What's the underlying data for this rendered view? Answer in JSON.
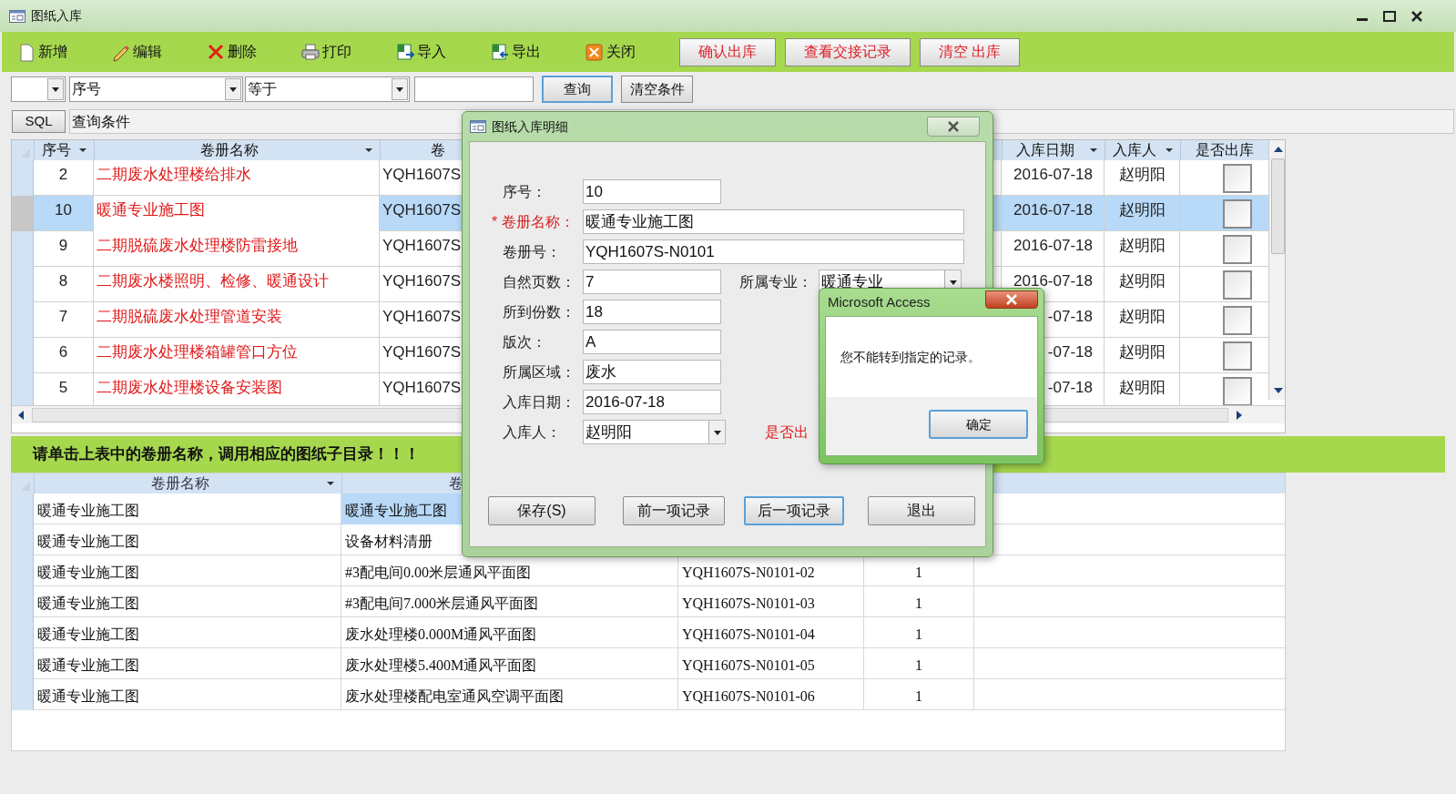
{
  "window": {
    "title": "图纸入库"
  },
  "toolbar": [
    {
      "kind": "new",
      "label": "新增"
    },
    {
      "kind": "edit",
      "label": "编辑"
    },
    {
      "kind": "delete",
      "label": "删除"
    },
    {
      "kind": "print",
      "label": "打印"
    },
    {
      "kind": "import",
      "label": "导入"
    },
    {
      "kind": "export",
      "label": "导出"
    },
    {
      "kind": "close",
      "label": "关闭"
    },
    {
      "kind": "action",
      "label": "确认出库"
    },
    {
      "kind": "action",
      "label": "查看交接记录"
    },
    {
      "kind": "action",
      "label": "清空  出库"
    }
  ],
  "filter": {
    "column": "序号",
    "operator": "等于",
    "buttons": [
      {
        "label": "查询",
        "focused": true
      },
      {
        "label": "清空条件",
        "focused": false
      }
    ]
  },
  "sql_bar": {
    "button": "SQL",
    "condition": "查询条件"
  },
  "records_table": {
    "columns": [
      {
        "label": "序号",
        "sort_menu": true
      },
      {
        "label": "卷册名称",
        "sort_menu": true
      },
      {
        "label": "卷"
      },
      {
        "label": "入库日期",
        "sort_menu": true
      },
      {
        "label": "入库人",
        "sort_menu": true
      },
      {
        "label": "是否出库",
        "sort_menu": false
      }
    ],
    "rows": [
      {
        "cells": [
          "2",
          "二期废水处理楼给排水",
          "YQH1607S",
          "2016-07-18",
          "赵明阳"
        ],
        "checked": false,
        "selected": false
      },
      {
        "cells": [
          "10",
          "暖通专业施工图",
          "YQH1607S",
          "2016-07-18",
          "赵明阳"
        ],
        "checked": false,
        "selected": true
      },
      {
        "cells": [
          "9",
          "二期脱硫废水处理楼防雷接地",
          "YQH1607S",
          "2016-07-18",
          "赵明阳"
        ],
        "checked": false,
        "selected": false
      },
      {
        "cells": [
          "8",
          "二期废水楼照明、检修、暖通设计",
          "YQH1607S",
          "2016-07-18",
          "赵明阳"
        ],
        "checked": false,
        "selected": false
      },
      {
        "cells": [
          "7",
          "二期脱硫废水处理管道安装",
          "YQH1607S",
          "-07-18",
          "赵明阳"
        ],
        "checked": false,
        "selected": false
      },
      {
        "cells": [
          "6",
          "二期废水处理楼箱罐管口方位",
          "YQH1607S",
          "-07-18",
          "赵明阳"
        ],
        "checked": false,
        "selected": false
      },
      {
        "cells": [
          "5",
          "二期废水处理楼设备安装图",
          "YQH1607S",
          "-07-18",
          "赵明阳"
        ],
        "checked": false,
        "selected": false
      }
    ]
  },
  "hint_banner": "请单击上表中的卷册名称，调用相应的图纸子目录！！！",
  "drawings_table": {
    "columns": [
      {
        "label": "卷册名称",
        "sort_menu": true
      },
      {
        "label": "卷"
      }
    ],
    "rows": [
      {
        "cells": [
          "暖通专业施工图",
          "暖通专业施工图"
        ],
        "selected": true
      },
      {
        "cells": [
          "暖通专业施工图",
          "设备材料清册"
        ],
        "selected": false
      },
      {
        "cells": [
          "暖通专业施工图",
          "#3配电间0.00米层通风平面图",
          "YQH1607S-N0101-02",
          "1"
        ],
        "selected": false
      },
      {
        "cells": [
          "暖通专业施工图",
          "#3配电间7.000米层通风平面图",
          "YQH1607S-N0101-03",
          "1"
        ],
        "selected": false
      },
      {
        "cells": [
          "暖通专业施工图",
          "废水处理楼0.000M通风平面图",
          "YQH1607S-N0101-04",
          "1"
        ],
        "selected": false
      },
      {
        "cells": [
          "暖通专业施工图",
          "废水处理楼5.400M通风平面图",
          "YQH1607S-N0101-05",
          "1"
        ],
        "selected": false
      },
      {
        "cells": [
          "暖通专业施工图",
          "废水处理楼配电室通风空调平面图",
          "YQH1607S-N0101-06",
          "1"
        ],
        "selected": false
      }
    ]
  },
  "detail_dialog": {
    "title": "图纸入库明细",
    "fields": [
      {
        "label": "序号：",
        "value": "10",
        "kind": "text",
        "required": false
      },
      {
        "label": "* 卷册名称：",
        "value": "暖通专业施工图",
        "kind": "wide",
        "required": true
      },
      {
        "label": "卷册号：",
        "value": "YQH1607S-N0101",
        "kind": "wide",
        "required": false
      },
      {
        "label": "自然页数：",
        "value": "7",
        "kind": "text",
        "required": false,
        "beside": {
          "kind": "combo",
          "label": "所属专业：",
          "value": "暖通专业"
        }
      },
      {
        "label": "所到份数：",
        "value": "18",
        "kind": "text",
        "required": false
      },
      {
        "label": "版次：",
        "value": "A",
        "kind": "text",
        "required": false
      },
      {
        "label": "所属区域：",
        "value": "废水",
        "kind": "text",
        "required": false
      },
      {
        "label": "入库日期：",
        "value": "2016-07-18",
        "kind": "text",
        "required": false
      },
      {
        "label": "入库人：",
        "value": "赵明阳",
        "kind": "combo",
        "required": false,
        "beside": {
          "kind": "label",
          "label": "是否出"
        }
      }
    ],
    "buttons": [
      {
        "label": "保存(S)",
        "focused": false
      },
      {
        "label": "前一项记录",
        "focused": false
      },
      {
        "label": "后一项记录",
        "focused": true
      },
      {
        "label": "退出",
        "focused": false
      }
    ]
  },
  "message_box": {
    "title": "Microsoft Access",
    "message": "您不能转到指定的记录。",
    "button": "确定"
  }
}
